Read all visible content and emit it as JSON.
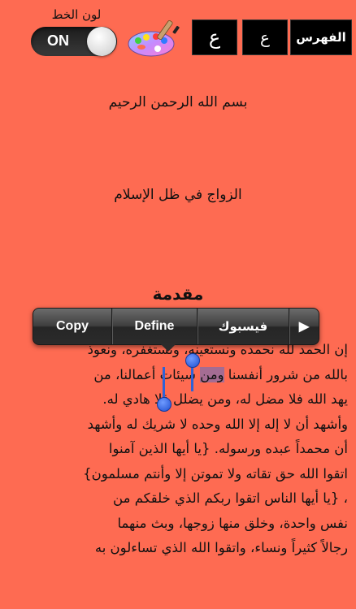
{
  "toolbar": {
    "font_color_label": "لون الخط",
    "toggle_state": "ON",
    "toggle_on": true,
    "font_large_label": "ع",
    "font_small_label": "ع",
    "index_label": "الفهرس",
    "palette_icon": "paint-palette-icon"
  },
  "colors": {
    "background": "#FE6B52",
    "button_bg": "#000000",
    "selection": "#5A6EC8",
    "handle": "#2F62D6"
  },
  "content": {
    "basmala": "بسم الله الرحمن الرحيم",
    "book_title": "الزواج في ظل الإسلام",
    "section_heading": "مقدمة",
    "lines": [
      "إن الحمد لله نحمده ونستعينه، ونستغفره، ونعوذ",
      "بالله من شرور أنفسنا ومن سيئات أعمالنا، من",
      "يهد الله فلا مضل له، ومن يضلل فلا هادي له.",
      "وأشهد أن لا إله إلا الله وحده لا شريك له وأشهد",
      "أن محمداً عبده ورسوله. {يا أيها الذين آمنوا",
      "اتقوا الله حق تقاته ولا تموتن إلا وأنتم مسلمون}",
      "، {يا أيها الناس اتقوا ربكم الذي خلقكم من",
      "نفس واحدة، وخلق منها زوجها، وبث منهما",
      "رجالاً كثيراً ونساء، واتقوا الله الذي تساءلون به"
    ],
    "line2_before": "بالله من شرور أنفسنا ",
    "line2_selected": "ومن",
    "line2_after": " سيئات أعمالنا، من"
  },
  "edit_menu": {
    "copy": "Copy",
    "define": "Define",
    "facebook": "فيسبوك",
    "more_arrow": "▶"
  }
}
